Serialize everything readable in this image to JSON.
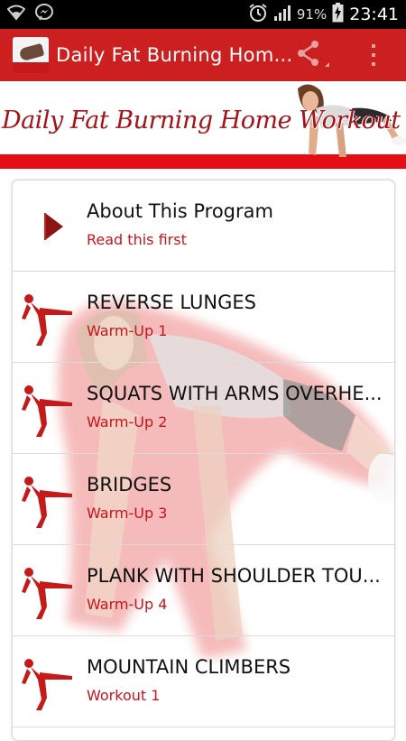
{
  "status_bar": {
    "battery_percent": "91%",
    "clock": "23:41",
    "icons": [
      "wifi-icon",
      "messenger-icon",
      "alarm-icon",
      "signal-icon",
      "battery-charging-icon"
    ]
  },
  "action_bar": {
    "title": "Daily Fat Burning Hom...",
    "actions": [
      "share-icon",
      "overflow-menu-icon"
    ],
    "color": "#cc1f1f"
  },
  "banner": {
    "title": "Daily Fat Burning Home Workout",
    "accent": "#e30f14"
  },
  "list": {
    "items": [
      {
        "title": "About This Program",
        "subtitle": "Read this first",
        "icon": "play-arrow-icon"
      },
      {
        "title": "REVERSE LUNGES",
        "subtitle": "Warm-Up 1",
        "icon": "exercise-figure-icon"
      },
      {
        "title": "SQUATS WITH ARMS OVERHE...",
        "subtitle": "Warm-Up 2",
        "icon": "exercise-figure-icon"
      },
      {
        "title": "BRIDGES",
        "subtitle": "Warm-Up 3",
        "icon": "exercise-figure-icon"
      },
      {
        "title": "PLANK WITH SHOULDER TOU...",
        "subtitle": "Warm-Up 4",
        "icon": "exercise-figure-icon"
      },
      {
        "title": "MOUNTAIN CLIMBERS",
        "subtitle": "Workout 1",
        "icon": "exercise-figure-icon"
      }
    ],
    "subtitle_color": "#c8141c"
  }
}
